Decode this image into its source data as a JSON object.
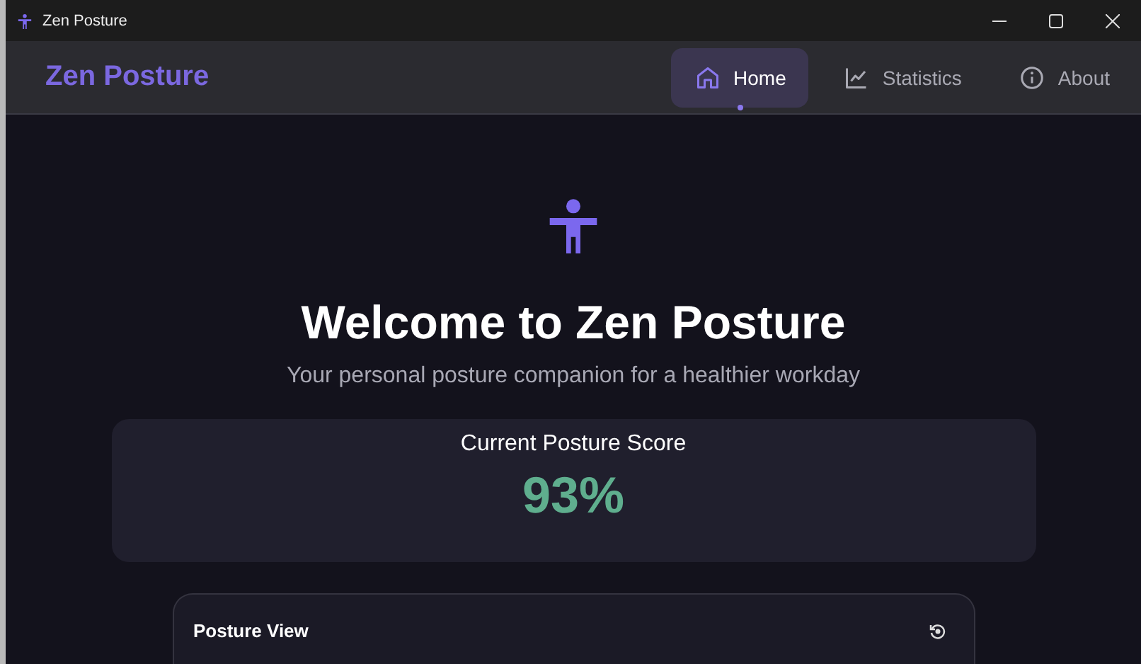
{
  "window": {
    "title": "Zen Posture"
  },
  "header": {
    "brand": "Zen Posture",
    "tabs": [
      {
        "kind": "home",
        "label": "Home",
        "selected": true
      },
      {
        "kind": "chart",
        "label": "Statistics",
        "selected": false
      },
      {
        "kind": "info",
        "label": "About",
        "selected": false
      }
    ]
  },
  "hero": {
    "title": "Welcome to Zen Posture",
    "subtitle": "Your personal posture companion for a healthier workday"
  },
  "score_card": {
    "label": "Current Posture Score",
    "value": "93%"
  },
  "posture_view": {
    "title": "Posture View"
  }
}
